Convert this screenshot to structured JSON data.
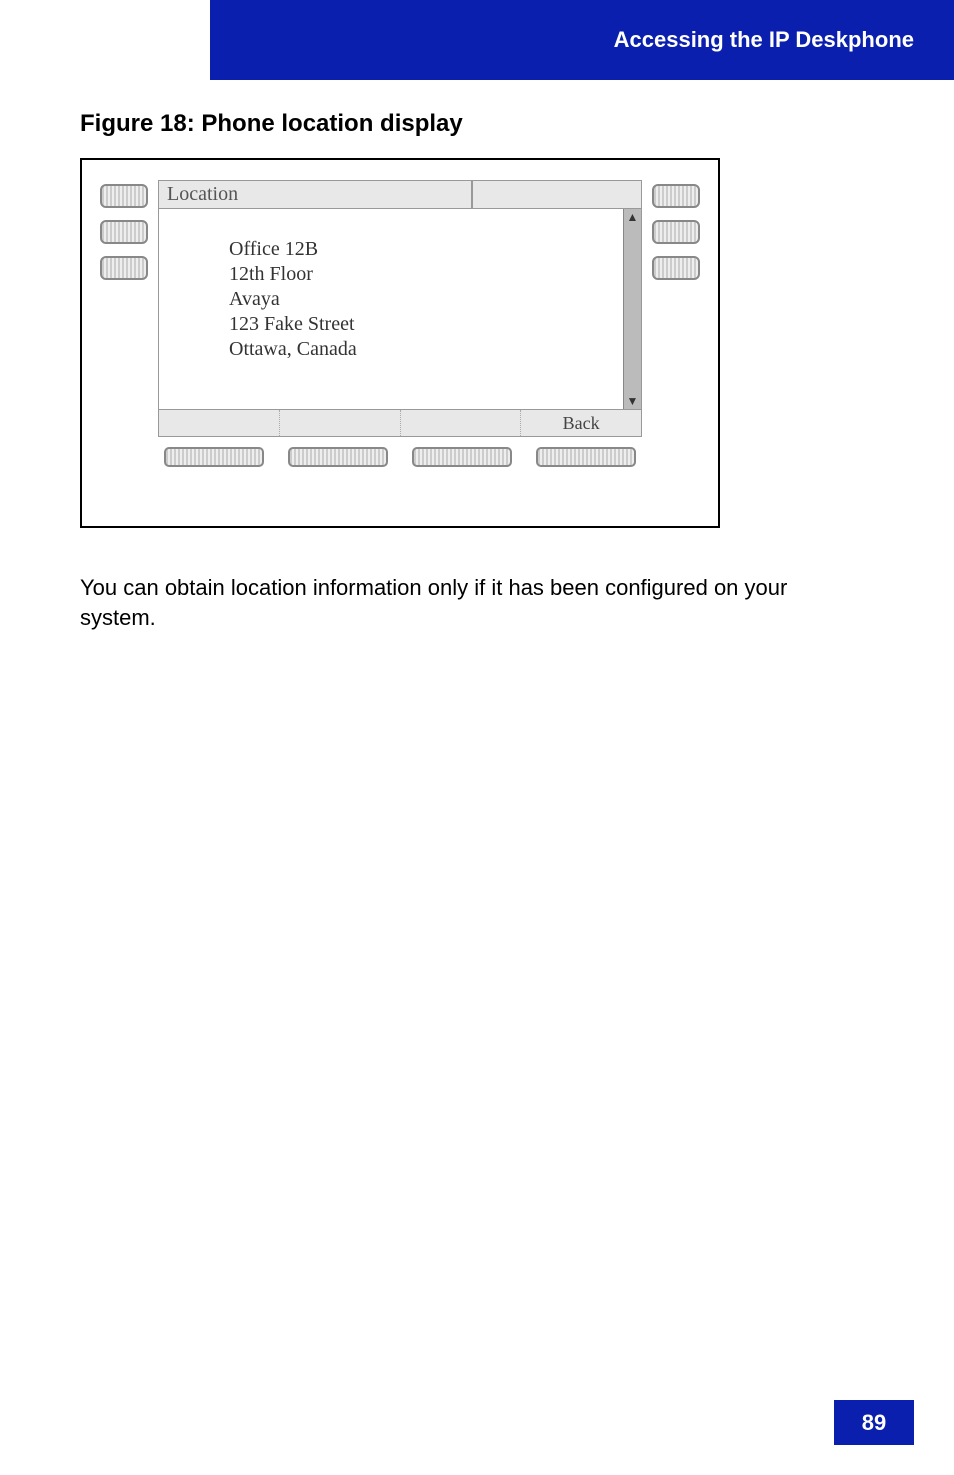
{
  "header": {
    "title": "Accessing the IP Deskphone"
  },
  "figure": {
    "caption": "Figure 18: Phone location display",
    "screen_title": "Location",
    "location_lines": {
      "l0": "Office 12B",
      "l1": "12th Floor",
      "l2": "Avaya",
      "l3": "123 Fake Street",
      "l4": "Ottawa, Canada"
    },
    "softkeys": {
      "k0": "",
      "k1": "",
      "k2": "",
      "k3": "Back"
    }
  },
  "body_text": "You can obtain location information only if it has been configured on your system.",
  "page_number": "89"
}
